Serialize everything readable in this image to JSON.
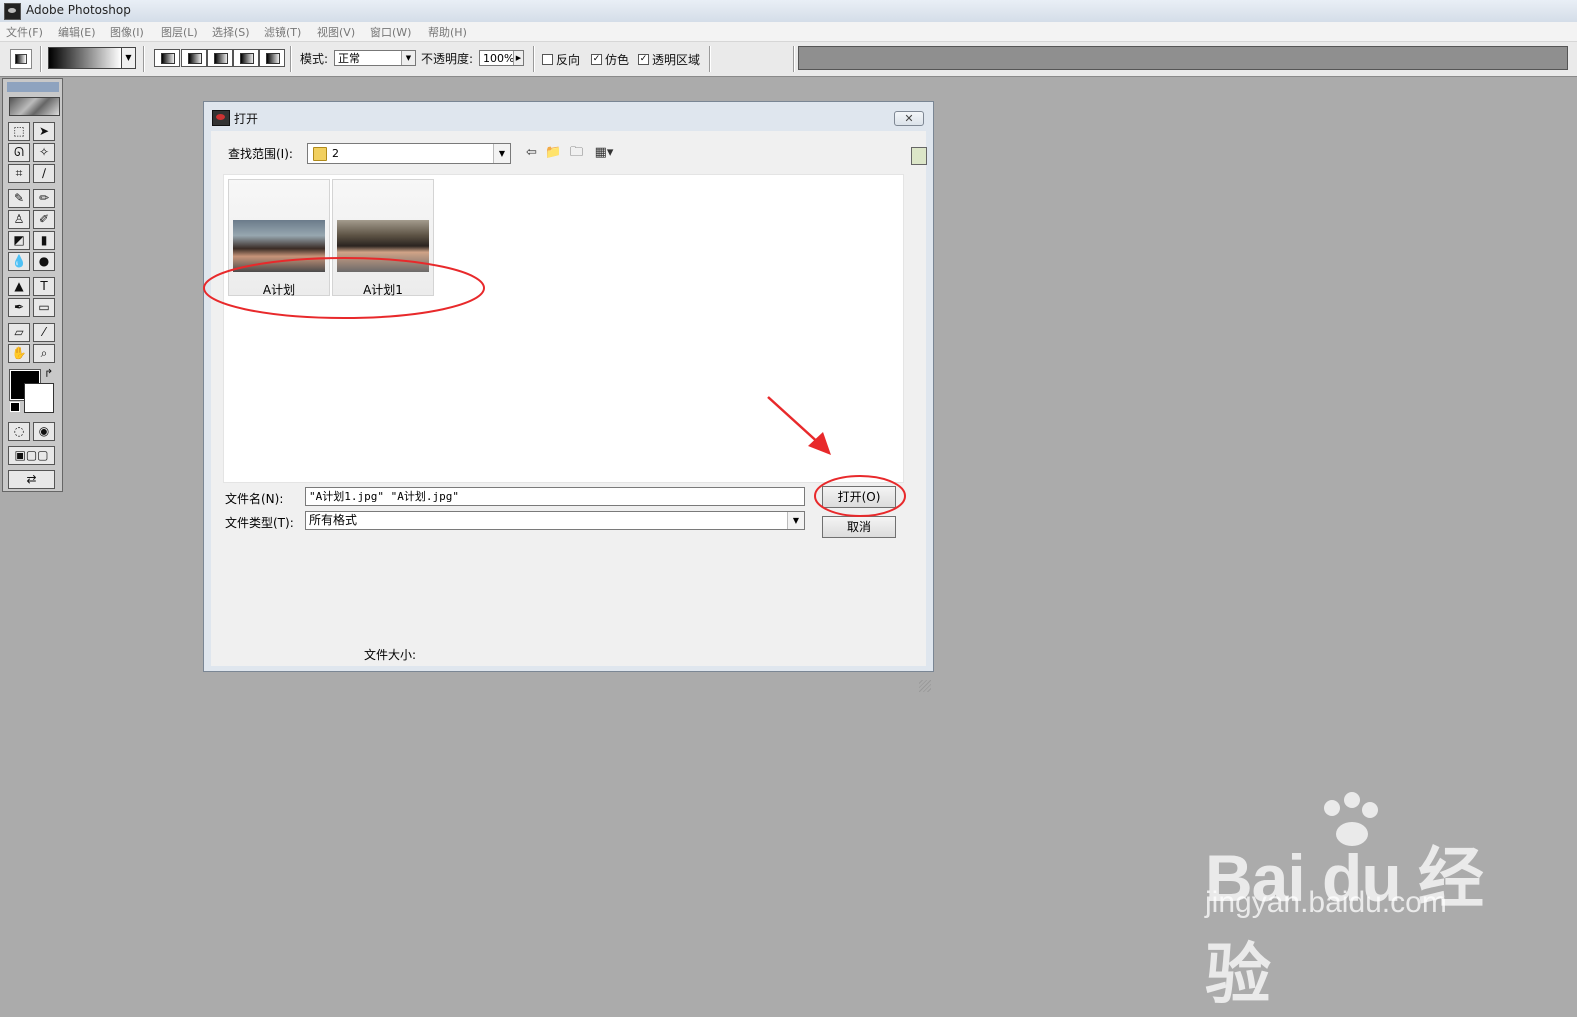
{
  "app": {
    "title": "Adobe Photoshop"
  },
  "menu": [
    "文件(F)",
    "编辑(E)",
    "图像(I)",
    "图层(L)",
    "选择(S)",
    "滤镜(T)",
    "视图(V)",
    "窗口(W)",
    "帮助(H)"
  ],
  "options": {
    "mode_label": "模式:",
    "mode_value": "正常",
    "opacity_label": "不透明度:",
    "opacity_value": "100%",
    "reverse_label": "反向",
    "reverse_checked": false,
    "dither_label": "仿色",
    "dither_checked": true,
    "transparency_label": "透明区域",
    "transparency_checked": true
  },
  "tools": [
    [
      "marquee-tool",
      "⬚"
    ],
    [
      "move-tool",
      "➤"
    ],
    [
      "lasso-tool",
      "ᘏ"
    ],
    [
      "magic-wand-tool",
      "✧"
    ],
    [
      "crop-tool",
      "⌗"
    ],
    [
      "slice-tool",
      "∕"
    ],
    [
      "healing-brush-tool",
      "✎"
    ],
    [
      "brush-tool",
      "✏"
    ],
    [
      "clone-stamp-tool",
      "♙"
    ],
    [
      "history-brush-tool",
      "✐"
    ],
    [
      "eraser-tool",
      "◩"
    ],
    [
      "gradient-tool",
      "▮"
    ],
    [
      "blur-tool",
      "💧"
    ],
    [
      "dodge-tool",
      "●"
    ],
    [
      "path-selection-tool",
      "▲"
    ],
    [
      "type-tool",
      "T"
    ],
    [
      "pen-tool",
      "✒"
    ],
    [
      "rectangle-tool",
      "▭"
    ],
    [
      "notes-tool",
      "▱"
    ],
    [
      "eyedropper-tool",
      "⁄"
    ],
    [
      "hand-tool",
      "✋"
    ],
    [
      "zoom-tool",
      "⌕"
    ]
  ],
  "colors": {
    "foreground": "#000000",
    "background": "#ffffff",
    "annotation": "#e8292b"
  },
  "dialog": {
    "title": "打开",
    "close_label": "✕",
    "look_in_label": "查找范围(I):",
    "look_in_value": "2",
    "files": [
      {
        "name": "A计划"
      },
      {
        "name": "A计划1"
      }
    ],
    "filename_label": "文件名(N):",
    "filename_value": "\"A计划1.jpg\" \"A计划.jpg\"",
    "filetype_label": "文件类型(T):",
    "filetype_value": "所有格式",
    "open_button": "打开(O)",
    "cancel_button": "取消",
    "filesize_label": "文件大小:"
  },
  "watermark": {
    "brand": "Bai du 经验",
    "sub": "jingyan.baidu.com"
  }
}
